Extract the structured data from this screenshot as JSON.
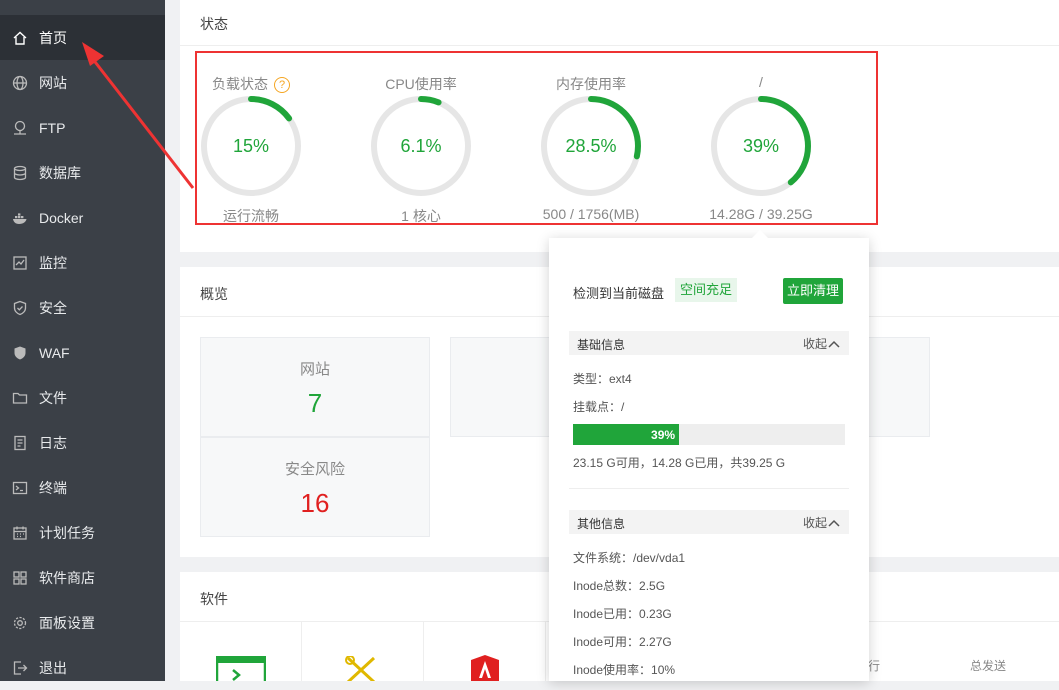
{
  "sidebar": {
    "items": [
      {
        "label": "首页",
        "icon": "home-icon"
      },
      {
        "label": "网站",
        "icon": "globe-icon"
      },
      {
        "label": "FTP",
        "icon": "ftp-icon"
      },
      {
        "label": "数据库",
        "icon": "database-icon"
      },
      {
        "label": "Docker",
        "icon": "docker-icon"
      },
      {
        "label": "监控",
        "icon": "monitor-icon"
      },
      {
        "label": "安全",
        "icon": "shield-icon"
      },
      {
        "label": "WAF",
        "icon": "waf-shield-icon"
      },
      {
        "label": "文件",
        "icon": "folder-icon"
      },
      {
        "label": "日志",
        "icon": "log-icon"
      },
      {
        "label": "终端",
        "icon": "terminal-icon"
      },
      {
        "label": "计划任务",
        "icon": "calendar-icon"
      },
      {
        "label": "软件商店",
        "icon": "grid-icon"
      },
      {
        "label": "面板设置",
        "icon": "gear-icon"
      },
      {
        "label": "退出",
        "icon": "logout-icon"
      }
    ]
  },
  "status": {
    "title": "状态",
    "gauges": [
      {
        "title": "负载状态",
        "value": "15%",
        "percent": 15,
        "sub": "运行流畅"
      },
      {
        "title": "CPU使用率",
        "value": "6.1%",
        "percent": 6.1,
        "sub": "1 核心"
      },
      {
        "title": "内存使用率",
        "value": "28.5%",
        "percent": 28.5,
        "sub": "500 / 1756(MB)"
      },
      {
        "title": "/",
        "value": "39%",
        "percent": 39,
        "sub": "14.28G / 39.25G"
      }
    ],
    "help_symbol": "?"
  },
  "overview": {
    "title": "概览",
    "cards": [
      {
        "label": "网站",
        "value": "7"
      },
      {
        "label": "安全风险",
        "value": "16"
      }
    ]
  },
  "software": {
    "title": "软件",
    "col_running": "行",
    "col_send": "总发送"
  },
  "disk_popup": {
    "detect_text": "检测到当前磁盘",
    "badge": "空间充足",
    "clean_button": "立即清理",
    "basic_title": "基础信息",
    "collapse": "收起",
    "type": "类型：ext4",
    "mount": "挂载点：/",
    "usage_percent": 39,
    "usage_label": "39%",
    "usage_text": "23.15 G可用，14.28 G已用，共39.25 G",
    "other_title": "其他信息",
    "fs": "文件系统：/dev/vda1",
    "inode_total": "Inode总数：2.5G",
    "inode_used": "Inode已用：0.23G",
    "inode_free": "Inode可用：2.27G",
    "inode_rate": "Inode使用率：10%"
  },
  "colors": {
    "accent": "#20a53a",
    "danger": "#e02020",
    "annotation": "#e33333",
    "sidebar_bg": "#3b4047"
  }
}
